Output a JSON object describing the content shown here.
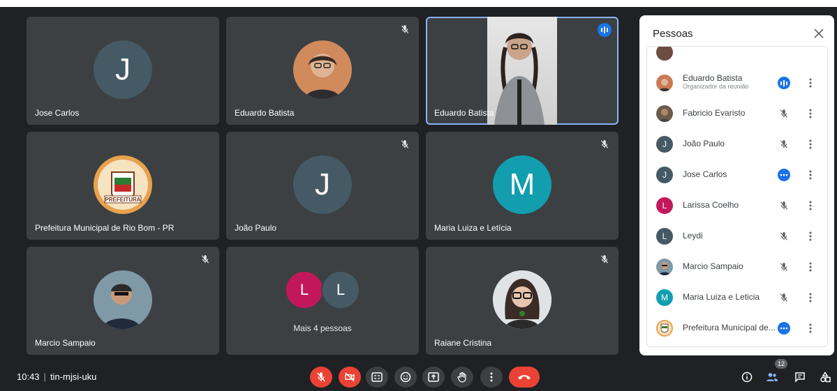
{
  "tiles": [
    {
      "name": "Jose Carlos",
      "initial": "J"
    },
    {
      "name": "Eduardo Batista"
    },
    {
      "name": "Eduardo Batista"
    },
    {
      "name": "Prefeitura Municipal de Rio Bom - PR",
      "logo_text": "PREFEITURA"
    },
    {
      "name": "João Paulo",
      "initial": "J"
    },
    {
      "name": "Maria Luiza e Letícia",
      "initial": "M"
    },
    {
      "name": "Marcio Sampaio"
    },
    {
      "more_label": "Mais 4 pessoas",
      "initials": [
        "L",
        "L"
      ]
    },
    {
      "name": "Raiane Cristina"
    }
  ],
  "panel": {
    "title": "Pessoas",
    "people": [
      {
        "name": "Eduardo Batista",
        "role": "Organizador da reunião",
        "status": "speaking"
      },
      {
        "name": "Fabricio Evaristo",
        "status": "muted"
      },
      {
        "name": "João Paulo",
        "initial": "J",
        "status": "muted"
      },
      {
        "name": "Jose Carlos",
        "initial": "J",
        "status": "more"
      },
      {
        "name": "Larissa Coelho",
        "initial": "L",
        "status": "muted"
      },
      {
        "name": "Leydi",
        "initial": "L",
        "status": "muted"
      },
      {
        "name": "Marcio Sampaio",
        "status": "muted"
      },
      {
        "name": "Maria Luiza e Leticia",
        "initial": "M",
        "status": "muted"
      },
      {
        "name": "Prefeitura Municipal de...",
        "status": "more"
      }
    ]
  },
  "bottom": {
    "time": "10:43",
    "meeting_code": "tin-mjsi-uku",
    "participant_count": "12"
  },
  "colors": {
    "background": "#202124",
    "tile": "#3c4043",
    "red": "#ea4335",
    "accent": "#1a73e8",
    "avatar_slate": "#455a64",
    "avatar_teal": "#129eaf",
    "avatar_pink": "#c2185b"
  },
  "icons": [
    "mic-off-icon",
    "speaking-icon",
    "close-icon",
    "more-vert-icon",
    "camera-off-icon",
    "captions-icon",
    "emoji-icon",
    "present-icon",
    "raise-hand-icon",
    "end-call-icon",
    "info-icon",
    "people-icon",
    "chat-icon",
    "activities-icon"
  ]
}
